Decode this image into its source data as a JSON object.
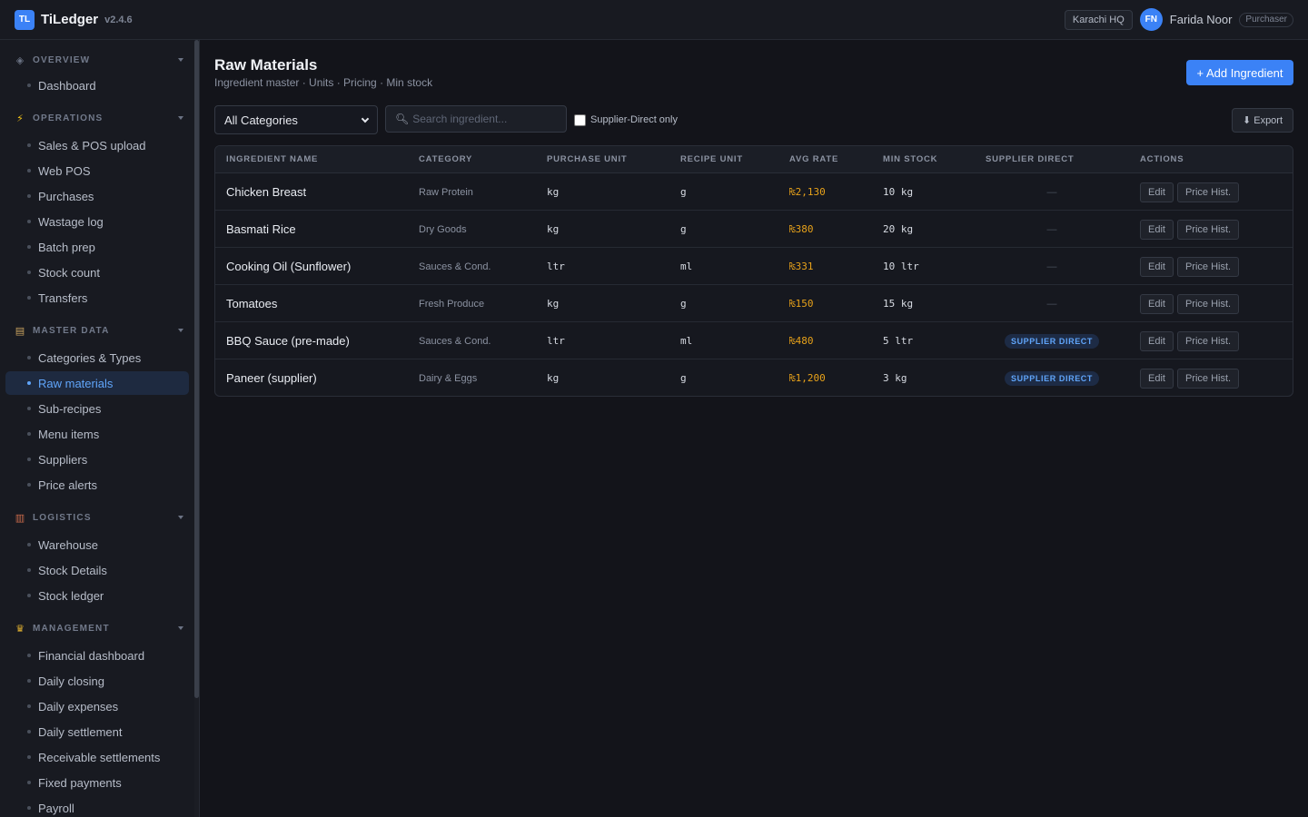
{
  "app": {
    "logo_text": "TL",
    "name": "TiLedger",
    "version": "v2.4.6",
    "branch": "Karachi HQ",
    "user_initials": "FN",
    "user_name": "Farida Noor",
    "user_role": "Purchaser"
  },
  "sidebar": {
    "sections": [
      {
        "label": "OVERVIEW",
        "icon": "diamond-icon",
        "items": [
          "Dashboard"
        ]
      },
      {
        "label": "OPERATIONS",
        "icon": "lightning-icon",
        "items": [
          "Sales & POS upload",
          "Web POS",
          "Purchases",
          "Wastage log",
          "Batch prep",
          "Stock count",
          "Transfers"
        ]
      },
      {
        "label": "MASTER DATA",
        "icon": "clipboard-icon",
        "items": [
          "Categories & Types",
          "Raw materials",
          "Sub-recipes",
          "Menu items",
          "Suppliers",
          "Price alerts"
        ]
      },
      {
        "label": "LOGISTICS",
        "icon": "warehouse-icon",
        "items": [
          "Warehouse",
          "Stock Details",
          "Stock ledger"
        ]
      },
      {
        "label": "MANAGEMENT",
        "icon": "crown-icon",
        "items": [
          "Financial dashboard",
          "Daily closing",
          "Daily expenses",
          "Daily settlement",
          "Receivable settlements",
          "Fixed payments",
          "Payroll"
        ]
      }
    ],
    "active_item": "Raw materials"
  },
  "page": {
    "title": "Raw Materials",
    "subtitle": "Ingredient master · Units · Pricing · Min stock",
    "add_button": "+ Add Ingredient",
    "category_select": "All Categories",
    "search_placeholder": "Search ingredient...",
    "supplier_direct_label": "Supplier-Direct only",
    "export_button": "⬇ Export"
  },
  "table": {
    "headers": [
      "INGREDIENT NAME",
      "CATEGORY",
      "PURCHASE UNIT",
      "RECIPE UNIT",
      "AVG RATE",
      "MIN STOCK",
      "SUPPLIER DIRECT",
      "ACTIONS"
    ],
    "rows": [
      {
        "name": "Chicken Breast",
        "category": "Raw Protein",
        "purchase_unit": "kg",
        "recipe_unit": "g",
        "avg_rate": "₨2,130",
        "min_stock": "10 kg",
        "supplier_direct": "—"
      },
      {
        "name": "Basmati Rice",
        "category": "Dry Goods",
        "purchase_unit": "kg",
        "recipe_unit": "g",
        "avg_rate": "₨380",
        "min_stock": "20 kg",
        "supplier_direct": "—"
      },
      {
        "name": "Cooking Oil (Sunflower)",
        "category": "Sauces & Cond.",
        "purchase_unit": "ltr",
        "recipe_unit": "ml",
        "avg_rate": "₨331",
        "min_stock": "10 ltr",
        "supplier_direct": "—"
      },
      {
        "name": "Tomatoes",
        "category": "Fresh Produce",
        "purchase_unit": "kg",
        "recipe_unit": "g",
        "avg_rate": "₨150",
        "min_stock": "15 kg",
        "supplier_direct": "—"
      },
      {
        "name": "BBQ Sauce (pre-made)",
        "category": "Sauces & Cond.",
        "purchase_unit": "ltr",
        "recipe_unit": "ml",
        "avg_rate": "₨480",
        "min_stock": "5 ltr",
        "supplier_direct": "SUPPLIER DIRECT"
      },
      {
        "name": "Paneer (supplier)",
        "category": "Dairy & Eggs",
        "purchase_unit": "kg",
        "recipe_unit": "g",
        "avg_rate": "₨1,200",
        "min_stock": "3 kg",
        "supplier_direct": "SUPPLIER DIRECT"
      }
    ],
    "edit_label": "Edit",
    "price_hist_label": "Price Hist."
  },
  "colors": {
    "accent": "#3b82f6",
    "rate": "#e8a21a",
    "background": "#13141a"
  }
}
